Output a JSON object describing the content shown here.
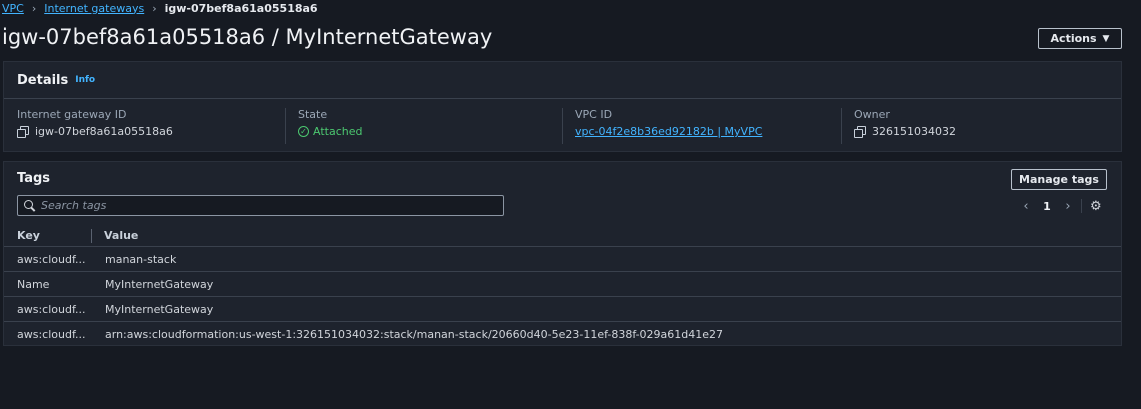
{
  "breadcrumb": {
    "items": [
      "VPC",
      "Internet gateways"
    ],
    "current": "igw-07bef8a61a05518a6"
  },
  "page": {
    "title": "igw-07bef8a61a05518a6 / MyInternetGateway",
    "actions_label": "Actions"
  },
  "details": {
    "title": "Details",
    "info_label": "Info",
    "fields": {
      "gateway_id": {
        "label": "Internet gateway ID",
        "value": "igw-07bef8a61a05518a6"
      },
      "state": {
        "label": "State",
        "value": "Attached"
      },
      "vpc_id": {
        "label": "VPC ID",
        "value": "vpc-04f2e8b36ed92182b | MyVPC"
      },
      "owner": {
        "label": "Owner",
        "value": "326151034032"
      }
    }
  },
  "tags": {
    "title": "Tags",
    "manage_label": "Manage tags",
    "search_placeholder": "Search tags",
    "page_number": "1",
    "columns": {
      "key": "Key",
      "value": "Value"
    },
    "rows": [
      {
        "key": "aws:cloudf...",
        "value": "manan-stack"
      },
      {
        "key": "Name",
        "value": "MyInternetGateway"
      },
      {
        "key": "aws:cloudf...",
        "value": "MyInternetGateway"
      },
      {
        "key": "aws:cloudf...",
        "value": "arn:aws:cloudformation:us-west-1:326151034032:stack/manan-stack/20660d40-5e23-11ef-838f-029a61d41e27"
      }
    ]
  },
  "colors": {
    "background": "#161a22",
    "panel": "#1e232d",
    "link": "#42b4ff",
    "success": "#4cc870"
  }
}
